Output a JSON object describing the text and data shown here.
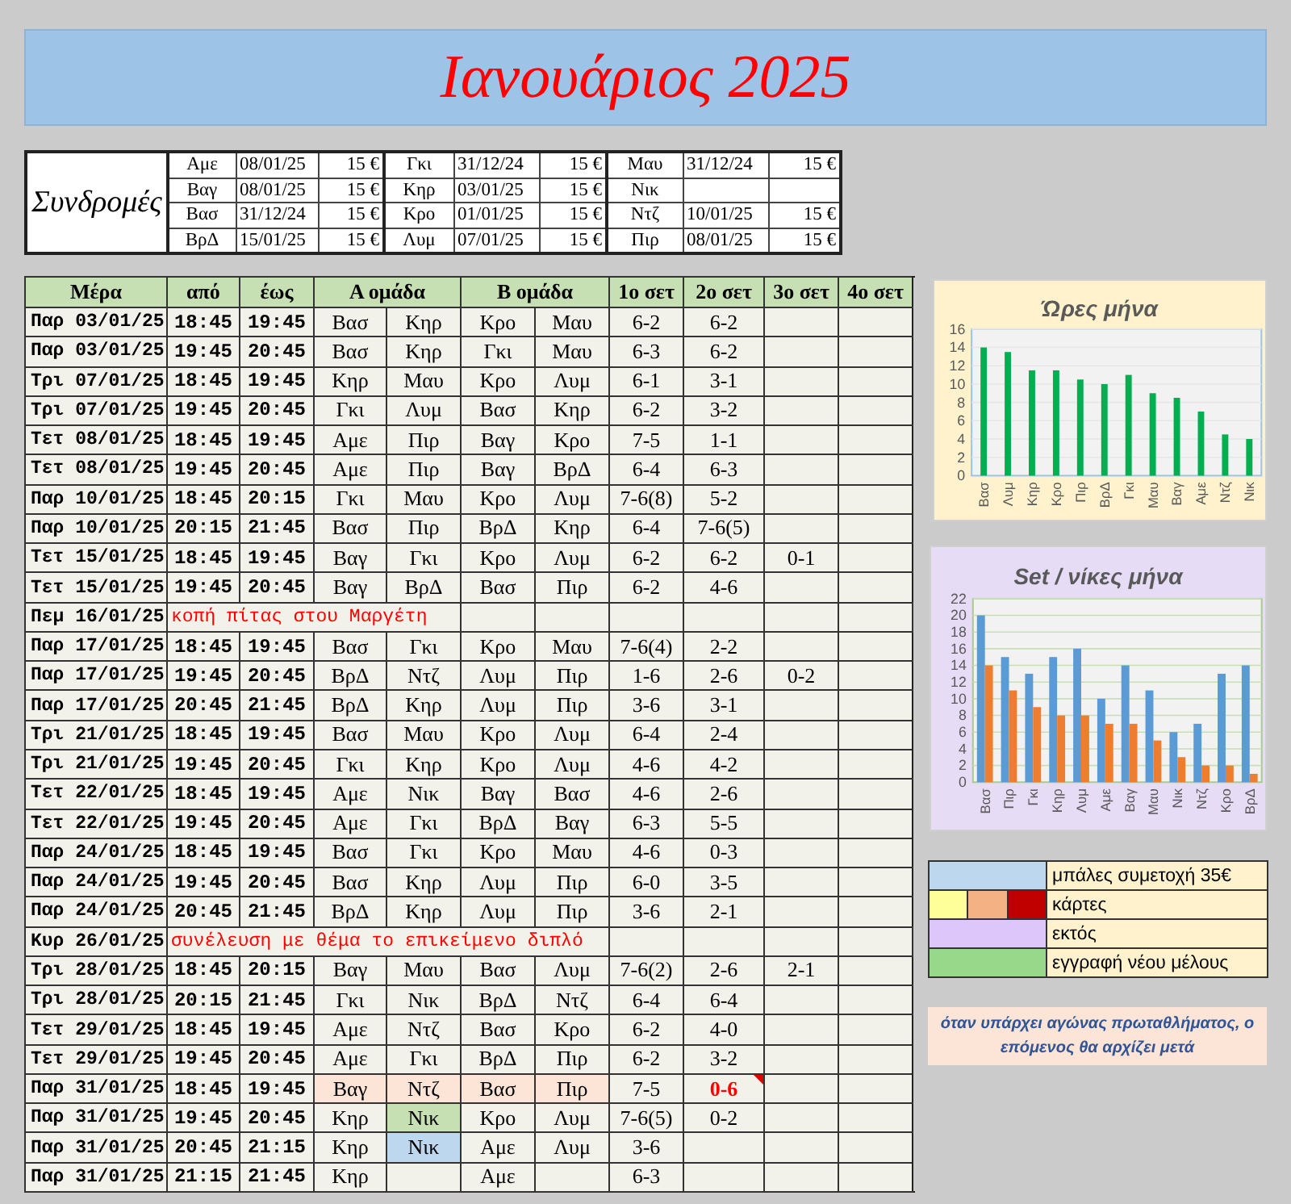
{
  "title": "Ιανουάριος 2025",
  "subscriptions": {
    "label": "Συνδρομές",
    "groups": [
      [
        {
          "name": "Αμε",
          "date": "08/01/25",
          "amount": "15 €"
        },
        {
          "name": "Βαγ",
          "date": "08/01/25",
          "amount": "15 €"
        },
        {
          "name": "Βασ",
          "date": "31/12/24",
          "amount": "15 €"
        },
        {
          "name": "ΒρΔ",
          "date": "15/01/25",
          "amount": "15 €"
        }
      ],
      [
        {
          "name": "Γκι",
          "date": "31/12/24",
          "amount": "15 €"
        },
        {
          "name": "Κηρ",
          "date": "03/01/25",
          "amount": "15 €"
        },
        {
          "name": "Κρο",
          "date": "01/01/25",
          "amount": "15 €"
        },
        {
          "name": "Λυμ",
          "date": "07/01/25",
          "amount": "15 €"
        }
      ],
      [
        {
          "name": "Μαυ",
          "date": "31/12/24",
          "amount": "15 €"
        },
        {
          "name": "Νικ"
        },
        {
          "name": "Ντζ",
          "date": "10/01/25",
          "amount": "15 €"
        },
        {
          "name": "Πιρ",
          "date": "08/01/25",
          "amount": "15 €"
        }
      ]
    ]
  },
  "schedule": {
    "columns": [
      {
        "label": "Μέρα",
        "kind": "day"
      },
      {
        "label": "από",
        "kind": "time"
      },
      {
        "label": "έως",
        "kind": "time"
      },
      {
        "label": "Α ομάδα",
        "kind": "team"
      },
      {
        "label": "Β ομάδα",
        "kind": "team"
      },
      {
        "label": "1ο σετ",
        "kind": "set"
      },
      {
        "label": "2ο σετ",
        "kind": "set"
      },
      {
        "label": "3ο σετ",
        "kind": "set"
      },
      {
        "label": "4ο σετ",
        "kind": "set"
      }
    ],
    "rows": [
      {
        "kind": "match",
        "day": "Παρ 03/01/25",
        "from": "18:45",
        "to": "19:45",
        "players": [
          "Βασ",
          "Κηρ",
          "Κρο",
          "Μαυ"
        ],
        "sets": [
          "6-2",
          "6-2"
        ]
      },
      {
        "kind": "match",
        "day": "Παρ 03/01/25",
        "from": "19:45",
        "to": "20:45",
        "players": [
          "Βασ",
          "Κηρ",
          "Γκι",
          "Μαυ"
        ],
        "sets": [
          "6-3",
          "6-2"
        ]
      },
      {
        "kind": "match",
        "day": "Τρι 07/01/25",
        "from": "18:45",
        "to": "19:45",
        "players": [
          "Κηρ",
          "Μαυ",
          "Κρο",
          "Λυμ"
        ],
        "sets": [
          "6-1",
          "3-1"
        ]
      },
      {
        "kind": "match",
        "day": "Τρι 07/01/25",
        "from": "19:45",
        "to": "20:45",
        "players": [
          "Γκι",
          "Λυμ",
          "Βασ",
          "Κηρ"
        ],
        "sets": [
          "6-2",
          "3-2"
        ]
      },
      {
        "kind": "match",
        "day": "Τετ 08/01/25",
        "from": "18:45",
        "to": "19:45",
        "players": [
          "Αμε",
          "Πιρ",
          "Βαγ",
          "Κρο"
        ],
        "sets": [
          "7-5",
          "1-1"
        ]
      },
      {
        "kind": "match",
        "day": "Τετ 08/01/25",
        "from": "19:45",
        "to": "20:45",
        "players": [
          "Αμε",
          "Πιρ",
          "Βαγ",
          "ΒρΔ"
        ],
        "sets": [
          "6-4",
          "6-3"
        ]
      },
      {
        "kind": "match",
        "day": "Παρ 10/01/25",
        "from": "18:45",
        "to": "20:15",
        "players": [
          "Γκι",
          "Μαυ",
          "Κρο",
          "Λυμ"
        ],
        "sets": [
          "7-6(8)",
          "5-2"
        ]
      },
      {
        "kind": "match",
        "day": "Παρ 10/01/25",
        "from": "20:15",
        "to": "21:45",
        "players": [
          "Βασ",
          "Πιρ",
          "ΒρΔ",
          "Κηρ"
        ],
        "sets": [
          "6-4",
          "7-6(5)"
        ]
      },
      {
        "kind": "match",
        "day": "Τετ 15/01/25",
        "from": "18:45",
        "to": "19:45",
        "players": [
          "Βαγ",
          "Γκι",
          "Κρο",
          "Λυμ"
        ],
        "sets": [
          "6-2",
          "6-2",
          "0-1"
        ]
      },
      {
        "kind": "match",
        "day": "Τετ 15/01/25",
        "from": "19:45",
        "to": "20:45",
        "players": [
          "Βαγ",
          "ΒρΔ",
          "Βασ",
          "Πιρ"
        ],
        "sets": [
          "6-2",
          "4-6"
        ]
      },
      {
        "kind": "event",
        "day": "Πεμ 16/01/25",
        "note": "κοπή πίτας στου Μαργέτη"
      },
      {
        "kind": "match",
        "day": "Παρ 17/01/25",
        "from": "18:45",
        "to": "19:45",
        "players": [
          "Βασ",
          "Γκι",
          "Κρο",
          "Μαυ"
        ],
        "sets": [
          "7-6(4)",
          "2-2"
        ]
      },
      {
        "kind": "match",
        "day": "Παρ 17/01/25",
        "from": "19:45",
        "to": "20:45",
        "players": [
          "ΒρΔ",
          "Ντζ",
          "Λυμ",
          "Πιρ"
        ],
        "sets": [
          "1-6",
          "2-6",
          "0-2"
        ]
      },
      {
        "kind": "match",
        "day": "Παρ 17/01/25",
        "from": "20:45",
        "to": "21:45",
        "players": [
          "ΒρΔ",
          "Κηρ",
          "Λυμ",
          "Πιρ"
        ],
        "sets": [
          "3-6",
          "3-1"
        ]
      },
      {
        "kind": "match",
        "day": "Τρι 21/01/25",
        "from": "18:45",
        "to": "19:45",
        "players": [
          "Βασ",
          "Μαυ",
          "Κρο",
          "Λυμ"
        ],
        "sets": [
          "6-4",
          "2-4"
        ]
      },
      {
        "kind": "match",
        "day": "Τρι 21/01/25",
        "from": "19:45",
        "to": "20:45",
        "players": [
          "Γκι",
          "Κηρ",
          "Κρο",
          "Λυμ"
        ],
        "sets": [
          "4-6",
          "4-2"
        ]
      },
      {
        "kind": "match",
        "day": "Τετ 22/01/25",
        "from": "18:45",
        "to": "19:45",
        "players": [
          "Αμε",
          "Νικ",
          "Βαγ",
          "Βασ"
        ],
        "sets": [
          "4-6",
          "2-6"
        ]
      },
      {
        "kind": "match",
        "day": "Τετ 22/01/25",
        "from": "19:45",
        "to": "20:45",
        "players": [
          "Αμε",
          "Γκι",
          "ΒρΔ",
          "Βαγ"
        ],
        "sets": [
          "6-3",
          "5-5"
        ]
      },
      {
        "kind": "match",
        "day": "Παρ 24/01/25",
        "from": "18:45",
        "to": "19:45",
        "players": [
          "Βασ",
          "Γκι",
          "Κρο",
          "Μαυ"
        ],
        "sets": [
          "4-6",
          "0-3"
        ]
      },
      {
        "kind": "match",
        "day": "Παρ 24/01/25",
        "from": "19:45",
        "to": "20:45",
        "players": [
          "Βασ",
          "Κηρ",
          "Λυμ",
          "Πιρ"
        ],
        "sets": [
          "6-0",
          "3-5"
        ]
      },
      {
        "kind": "match",
        "day": "Παρ 24/01/25",
        "from": "20:45",
        "to": "21:45",
        "players": [
          "ΒρΔ",
          "Κηρ",
          "Λυμ",
          "Πιρ"
        ],
        "sets": [
          "3-6",
          "2-1"
        ]
      },
      {
        "kind": "event",
        "day": "Κυρ 26/01/25",
        "note": "συνέλευση με θέμα το επικείμενο διπλό"
      },
      {
        "kind": "match",
        "day": "Τρι 28/01/25",
        "from": "18:45",
        "to": "20:15",
        "players": [
          "Βαγ",
          "Μαυ",
          "Βασ",
          "Λυμ"
        ],
        "sets": [
          "7-6(2)",
          "2-6",
          "2-1"
        ]
      },
      {
        "kind": "match",
        "day": "Τρι 28/01/25",
        "from": "20:15",
        "to": "21:45",
        "players": [
          "Γκι",
          "Νικ",
          "ΒρΔ",
          "Ντζ"
        ],
        "sets": [
          "6-4",
          "6-4"
        ]
      },
      {
        "kind": "match",
        "day": "Τετ 29/01/25",
        "from": "18:45",
        "to": "19:45",
        "players": [
          "Αμε",
          "Ντζ",
          "Βασ",
          "Κρο"
        ],
        "sets": [
          "6-2",
          "4-0"
        ]
      },
      {
        "kind": "match",
        "day": "Τετ 29/01/25",
        "from": "19:45",
        "to": "20:45",
        "players": [
          "Αμε",
          "Γκι",
          "ΒρΔ",
          "Πιρ"
        ],
        "sets": [
          "6-2",
          "3-2"
        ]
      },
      {
        "kind": "match",
        "day": "Παρ 31/01/25",
        "from": "18:45",
        "to": "19:45",
        "players": [
          {
            "name": "Βαγ",
            "color": "#fce4d6"
          },
          {
            "name": "Ντζ",
            "color": "#fce4d6"
          },
          {
            "name": "Βασ",
            "color": "#fce4d6"
          },
          {
            "name": "Πιρ",
            "color": "#fce4d6"
          }
        ],
        "sets": [
          "7-5",
          {
            "text": "0-6",
            "emphasis": true,
            "comment": true
          }
        ]
      },
      {
        "kind": "match",
        "day": "Παρ 31/01/25",
        "from": "19:45",
        "to": "20:45",
        "players": [
          "Κηρ",
          {
            "name": "Νικ",
            "color": "#c6e0b4"
          },
          "Κρο",
          "Λυμ"
        ],
        "sets": [
          "7-6(5)",
          "0-2"
        ]
      },
      {
        "kind": "match",
        "day": "Παρ 31/01/25",
        "from": "20:45",
        "to": "21:15",
        "players": [
          "Κηρ",
          {
            "name": "Νικ",
            "color": "#bdd7ee"
          },
          "Αμε",
          "Λυμ"
        ],
        "sets": [
          "3-6"
        ]
      },
      {
        "kind": "match",
        "day": "Παρ 31/01/25",
        "from": "21:15",
        "to": "21:45",
        "team_a": [
          "Κηρ"
        ],
        "team_b": [
          "Αμε"
        ],
        "sets": [
          "6-3"
        ]
      }
    ]
  },
  "charts": [
    {
      "chart_data": {
        "type": "bar",
        "title": "Ώρες μήνα",
        "categories": [
          "Βασ",
          "Λυμ",
          "Κηρ",
          "Κρο",
          "Πιρ",
          "ΒρΔ",
          "Γκι",
          "Μαυ",
          "Βαγ",
          "Αμε",
          "Ντζ",
          "Νικ"
        ],
        "series": [
          {
            "color": "#00b050",
            "values": [
              14,
              13.5,
              11.5,
              11.5,
              10.5,
              10,
              11,
              9,
              8.5,
              7,
              4.5,
              4
            ]
          }
        ],
        "ylim": [
          0,
          16
        ],
        "yticks": [
          0,
          2,
          4,
          6,
          8,
          10,
          12,
          14,
          16
        ],
        "grid": true
      }
    },
    {
      "chart_data": {
        "type": "bar",
        "title": "Set / νίκες μήνα",
        "categories": [
          "Βασ",
          "Πιρ",
          "Γκι",
          "Κηρ",
          "Λυμ",
          "Αμε",
          "Βαγ",
          "Μαυ",
          "Νικ",
          "Ντζ",
          "Κρο",
          "ΒρΔ"
        ],
        "series": [
          {
            "color": "#5b9bd5",
            "values": [
              20,
              15,
              13,
              15,
              16,
              10,
              14,
              11,
              6,
              7,
              13,
              14
            ]
          },
          {
            "color": "#ed7d31",
            "values": [
              14,
              11,
              9,
              8,
              8,
              7,
              7,
              5,
              3,
              2,
              2,
              1
            ]
          }
        ],
        "ylim": [
          0,
          22
        ],
        "yticks": [
          0,
          2,
          4,
          6,
          8,
          10,
          12,
          14,
          16,
          18,
          20,
          22
        ],
        "grid": true
      }
    }
  ],
  "legend": {
    "items": [
      {
        "swatches": [
          {
            "color": "#bdd7ee"
          }
        ],
        "label": "μπάλες συμετοχή 35€"
      },
      {
        "swatches": [
          {
            "color": "#ffff99"
          },
          {
            "color": "#f4b183"
          },
          {
            "color": "#c00000"
          }
        ],
        "label": "κάρτες"
      },
      {
        "swatches": [
          {
            "color": "#dcc6fa"
          }
        ],
        "label": "εκτός"
      },
      {
        "swatches": [
          {
            "color": "#98d88a"
          }
        ],
        "label": "εγγραφή νέου μέλους"
      }
    ]
  },
  "note": "όταν υπάρχει αγώνας πρωταθλήματος, ο επόμενος θα αρχίζει μετά"
}
